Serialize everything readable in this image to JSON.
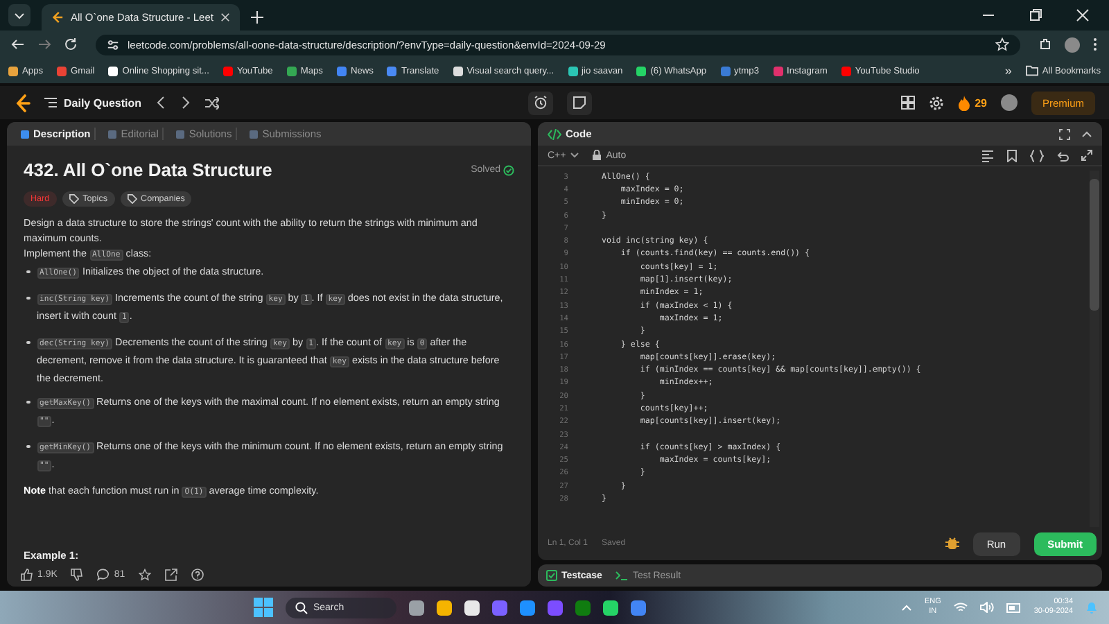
{
  "browser": {
    "tab_title": "All O`one Data Structure - Leet",
    "url": "leetcode.com/problems/all-oone-data-structure/description/?envType=daily-question&envId=2024-09-29",
    "bookmarks": [
      {
        "label": "Apps",
        "color": "#e8a33d"
      },
      {
        "label": "Gmail",
        "color": "#ea4335"
      },
      {
        "label": "Online Shopping sit...",
        "color": "#ffffff"
      },
      {
        "label": "YouTube",
        "color": "#ff0000"
      },
      {
        "label": "Maps",
        "color": "#34a853"
      },
      {
        "label": "News",
        "color": "#4285f4"
      },
      {
        "label": "Translate",
        "color": "#4a8af4"
      },
      {
        "label": "Visual search query...",
        "color": "#dddddd"
      },
      {
        "label": "jio saavan",
        "color": "#2bc5b4"
      },
      {
        "label": "(6) WhatsApp",
        "color": "#25d366"
      },
      {
        "label": "ytmp3",
        "color": "#3a7bd5"
      },
      {
        "label": "Instagram",
        "color": "#e1306c"
      },
      {
        "label": "YouTube Studio",
        "color": "#ff0000"
      }
    ],
    "more": "»",
    "all_bookmarks": "All Bookmarks"
  },
  "header": {
    "title": "Daily Question",
    "streak": "29",
    "premium": "Premium"
  },
  "problem": {
    "tabs": [
      {
        "label": "Description",
        "selected": true
      },
      {
        "label": "Editorial",
        "selected": false
      },
      {
        "label": "Solutions",
        "selected": false
      },
      {
        "label": "Submissions",
        "selected": false
      }
    ],
    "title": "432. All O`one Data Structure",
    "status": "Solved",
    "difficulty": "Hard",
    "tags": [
      "Topics",
      "Companies"
    ],
    "paragraphs": [
      {
        "kind": "para",
        "segments": [
          {
            "kind": "text",
            "text": "Design a data structure to store the strings' count with the ability to return the strings with minimum and maximum counts."
          }
        ]
      },
      {
        "kind": "para",
        "segments": [
          {
            "kind": "text",
            "text": "Implement the "
          },
          {
            "kind": "code",
            "text": "AllOne"
          },
          {
            "kind": "text",
            "text": " class:"
          }
        ]
      },
      {
        "kind": "bullet",
        "segments": [
          {
            "kind": "code",
            "text": "AllOne()"
          },
          {
            "kind": "text",
            "text": " Initializes the object of the data structure."
          }
        ]
      },
      {
        "kind": "bullet",
        "segments": [
          {
            "kind": "code",
            "text": "inc(String key)"
          },
          {
            "kind": "text",
            "text": " Increments the count of the string "
          },
          {
            "kind": "code",
            "text": "key"
          },
          {
            "kind": "text",
            "text": " by "
          },
          {
            "kind": "code",
            "text": "1"
          },
          {
            "kind": "text",
            "text": ". If "
          },
          {
            "kind": "code",
            "text": "key"
          },
          {
            "kind": "text",
            "text": " does not exist in the data structure, insert it with count "
          },
          {
            "kind": "code",
            "text": "1"
          },
          {
            "kind": "text",
            "text": "."
          }
        ]
      },
      {
        "kind": "bullet",
        "segments": [
          {
            "kind": "code",
            "text": "dec(String key)"
          },
          {
            "kind": "text",
            "text": " Decrements the count of the string "
          },
          {
            "kind": "code",
            "text": "key"
          },
          {
            "kind": "text",
            "text": " by "
          },
          {
            "kind": "code",
            "text": "1"
          },
          {
            "kind": "text",
            "text": ". If the count of "
          },
          {
            "kind": "code",
            "text": "key"
          },
          {
            "kind": "text",
            "text": " is "
          },
          {
            "kind": "code",
            "text": "0"
          },
          {
            "kind": "text",
            "text": " after the decrement, remove it from the data structure. It is guaranteed that "
          },
          {
            "kind": "code",
            "text": "key"
          },
          {
            "kind": "text",
            "text": " exists in the data structure before the decrement."
          }
        ]
      },
      {
        "kind": "bullet",
        "segments": [
          {
            "kind": "code",
            "text": "getMaxKey()"
          },
          {
            "kind": "text",
            "text": " Returns one of the keys with the maximal count. If no element exists, return an empty string "
          },
          {
            "kind": "code",
            "text": "\"\""
          },
          {
            "kind": "text",
            "text": "."
          }
        ]
      },
      {
        "kind": "bullet",
        "segments": [
          {
            "kind": "code",
            "text": "getMinKey()"
          },
          {
            "kind": "text",
            "text": " Returns one of the keys with the minimum count. If no element exists, return an empty string "
          },
          {
            "kind": "code",
            "text": "\"\""
          },
          {
            "kind": "text",
            "text": "."
          }
        ]
      },
      {
        "kind": "para",
        "segments": [
          {
            "kind": "bold",
            "text": "Note"
          },
          {
            "kind": "text",
            "text": " that each function must run in "
          },
          {
            "kind": "code",
            "text": "O(1)"
          },
          {
            "kind": "text",
            "text": " average time complexity."
          }
        ]
      }
    ],
    "example_heading": "Example 1:",
    "likes": "1.9K",
    "comments": "81"
  },
  "editor": {
    "title": "Code",
    "language": "C++",
    "mode": "Auto",
    "lines": [
      {
        "n": "3",
        "text": "    AllOne() {"
      },
      {
        "n": "4",
        "text": "        maxIndex = 0;"
      },
      {
        "n": "5",
        "text": "        minIndex = 0;"
      },
      {
        "n": "6",
        "text": "    }"
      },
      {
        "n": "7"
      },
      {
        "n": "8",
        "text": "    void inc(string key) {"
      },
      {
        "n": "9",
        "text": "        if (counts.find(key) == counts.end()) {"
      },
      {
        "n": "10",
        "text": "            counts[key] = 1;"
      },
      {
        "n": "11",
        "text": "            map[1].insert(key);"
      },
      {
        "n": "12",
        "text": "            minIndex = 1;"
      },
      {
        "n": "13",
        "text": "            if (maxIndex < 1) {"
      },
      {
        "n": "14",
        "text": "                maxIndex = 1;"
      },
      {
        "n": "15",
        "text": "            }"
      },
      {
        "n": "16",
        "text": "        } else {"
      },
      {
        "n": "17",
        "text": "            map[counts[key]].erase(key);"
      },
      {
        "n": "18",
        "text": "            if (minIndex == counts[key] && map[counts[key]].empty()) {"
      },
      {
        "n": "19",
        "text": "                minIndex++;"
      },
      {
        "n": "20",
        "text": "            }"
      },
      {
        "n": "21",
        "text": "            counts[key]++;"
      },
      {
        "n": "22",
        "text": "            map[counts[key]].insert(key);"
      },
      {
        "n": "23"
      },
      {
        "n": "24",
        "text": "            if (counts[key] > maxIndex) {"
      },
      {
        "n": "25",
        "text": "                maxIndex = counts[key];"
      },
      {
        "n": "26",
        "text": "            }"
      },
      {
        "n": "27",
        "text": "        }"
      },
      {
        "n": "28",
        "text": "    }"
      }
    ],
    "cursor": "Ln 1, Col 1",
    "save_state": "Saved",
    "run": "Run",
    "submit": "Submit",
    "bottom_tabs": [
      {
        "label": "Testcase",
        "selected": true
      },
      {
        "label": "Test Result",
        "selected": false
      }
    ]
  },
  "taskbar": {
    "search_placeholder": "Search",
    "language": "ENG",
    "region": "IN",
    "time": "00:34",
    "date": "30-09-2024"
  }
}
